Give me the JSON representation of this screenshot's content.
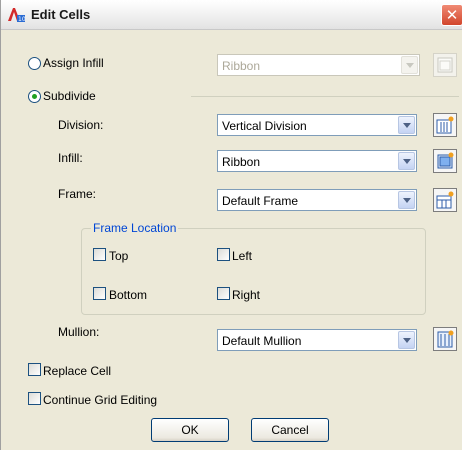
{
  "window": {
    "title": "Edit Cells",
    "close_glyph": "✕"
  },
  "colors": {
    "dialog_bg": "#ece9d8",
    "checked_dot": "#21a121",
    "group_title": "#0046d5",
    "close_red": "#d2462c"
  },
  "assign_infill": {
    "label": "Assign Infill",
    "selected": false,
    "combo_value": "Ribbon",
    "enabled": false
  },
  "subdivide": {
    "label": "Subdivide",
    "selected": true
  },
  "division": {
    "label": "Division:",
    "value": "Vertical Division"
  },
  "infill": {
    "label": "Infill:",
    "value": "Ribbon"
  },
  "frame": {
    "label": "Frame:",
    "value": "Default Frame"
  },
  "frame_location": {
    "title": "Frame Location",
    "top": {
      "label": "Top",
      "checked": false
    },
    "left": {
      "label": "Left",
      "checked": false
    },
    "bottom": {
      "label": "Bottom",
      "checked": false
    },
    "right": {
      "label": "Right",
      "checked": false
    }
  },
  "mullion": {
    "label": "Mullion:",
    "value": "Default Mullion"
  },
  "replace_cell": {
    "label": "Replace Cell",
    "checked": false
  },
  "continue_grid": {
    "label": "Continue Grid Editing",
    "checked": false
  },
  "buttons": {
    "ok": "OK",
    "cancel": "Cancel"
  },
  "icons": [
    "app-icon",
    "close-icon",
    "radio-icon",
    "checkbox-icon",
    "dropdown-arrow-icon",
    "style-manager-icon"
  ]
}
